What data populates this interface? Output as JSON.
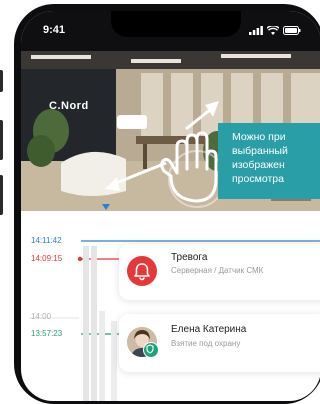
{
  "status_bar": {
    "time": "9:41"
  },
  "photo": {
    "sign_text": "C.Nord"
  },
  "tooltip": {
    "lines": [
      "Можно при",
      "выбранный",
      "изображен",
      "просмотра"
    ]
  },
  "timeline": {
    "labels": [
      {
        "text": "14:11:42",
        "color": "#2a7fd0"
      },
      {
        "text": "14:09:15",
        "color": "#e53939"
      },
      {
        "text": "14:00",
        "color": "#b0b0b0"
      },
      {
        "text": "13:57:23",
        "color": "#1fa27a"
      }
    ],
    "events": [
      {
        "title": "Тревога",
        "subtitle": "Серверная / Датчик СМК"
      },
      {
        "title": "Елена Катерина",
        "subtitle": "Взятие под охрану"
      }
    ]
  },
  "colors": {
    "accent_blue": "#2a7fd0",
    "alarm_red": "#e53939",
    "tooltip_teal": "#2a9ea7",
    "guard_green": "#1fa27a"
  }
}
